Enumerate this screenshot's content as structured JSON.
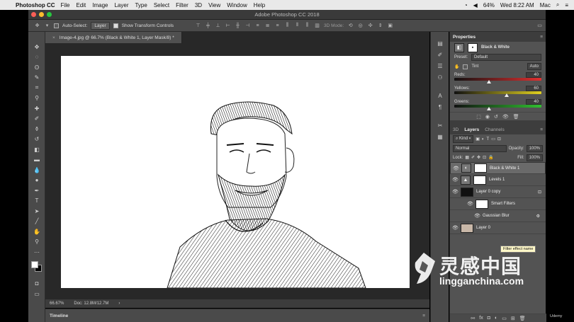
{
  "menubar": {
    "app": "Photoshop CC",
    "items": [
      "File",
      "Edit",
      "Image",
      "Layer",
      "Type",
      "Select",
      "Filter",
      "3D",
      "View",
      "Window",
      "Help"
    ],
    "battery": "64%",
    "datetime": "Wed 8:22 AM",
    "user": "Mac"
  },
  "window": {
    "title": "Adobe Photoshop CC 2018"
  },
  "options": {
    "auto_select_label": "Auto-Select:",
    "auto_select_value": "Layer",
    "show_transform_label": "Show Transform Controls",
    "mode_3d": "3D Mode:"
  },
  "document": {
    "tab_title": "Image-4.jpg @ 66.7% (Black & White 1, Layer Mask/8) *",
    "zoom": "66.67%",
    "doc_size": "Doc: 12.8M/12.7M",
    "timeline_label": "Timeline"
  },
  "properties": {
    "title": "Properties",
    "adjustment": "Black & White",
    "preset_label": "Preset:",
    "preset_value": "Default",
    "tint_label": "Tint",
    "auto_label": "Auto",
    "sliders": [
      {
        "label": "Reds:",
        "value": "40",
        "pos": 0.4
      },
      {
        "label": "Yellows:",
        "value": "60",
        "pos": 0.6
      },
      {
        "label": "Greens:",
        "value": "40",
        "pos": 0.4
      }
    ]
  },
  "layers_panel": {
    "tabs": [
      "3D",
      "Layers",
      "Channels"
    ],
    "kind_label": "Kind",
    "blend": "Normal",
    "opacity_label": "Opacity:",
    "opacity": "100%",
    "lock_label": "Lock:",
    "fill_label": "Fill:",
    "fill": "100%",
    "layers": [
      {
        "name": "Black & White 1",
        "selected": true
      },
      {
        "name": "Levels 1",
        "selected": false
      },
      {
        "name": "Layer 0 copy",
        "selected": false
      },
      {
        "name": "Smart Filters",
        "selected": false
      },
      {
        "name": "Gaussian Blur",
        "selected": false
      },
      {
        "name": "Layer 0",
        "selected": false
      }
    ],
    "tooltip": "Filter effect name"
  },
  "watermark": {
    "cn": "灵感中国",
    "en": "lingganchina.com"
  },
  "udemy": "Udemy",
  "colors": {
    "canvas": "#ffffff",
    "panel": "#535353",
    "accent": "#2a6ad6"
  }
}
